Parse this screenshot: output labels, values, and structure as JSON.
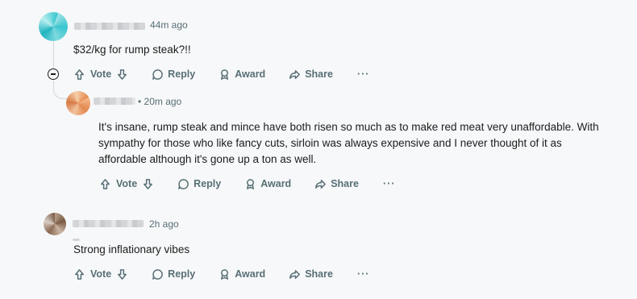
{
  "comments": [
    {
      "timestamp": "44m ago",
      "body": "$32/kg for rump steak?!!",
      "actions": {
        "vote": "Vote",
        "reply": "Reply",
        "award": "Award",
        "share": "Share",
        "more": "···"
      }
    },
    {
      "timestamp": "• 20m ago",
      "body_lines": [
        "It's insane, rump steak and mince have both risen so much as to make red meat very unaffordable. With",
        "sympathy for those who like fancy cuts, sirloin was always expensive and I never thought of it as",
        "affordable although it's gone up a ton as well."
      ],
      "actions": {
        "vote": "Vote",
        "reply": "Reply",
        "award": "Award",
        "share": "Share",
        "more": "···"
      }
    },
    {
      "timestamp": "2h ago",
      "body": "Strong inflationary vibes",
      "actions": {
        "vote": "Vote",
        "reply": "Reply",
        "award": "Award",
        "share": "Share",
        "more": "···"
      }
    }
  ],
  "icons": [
    "arrow-up-icon",
    "arrow-down-icon",
    "comment-bubble-icon",
    "award-icon",
    "share-icon",
    "more-icon",
    "collapse-icon"
  ]
}
